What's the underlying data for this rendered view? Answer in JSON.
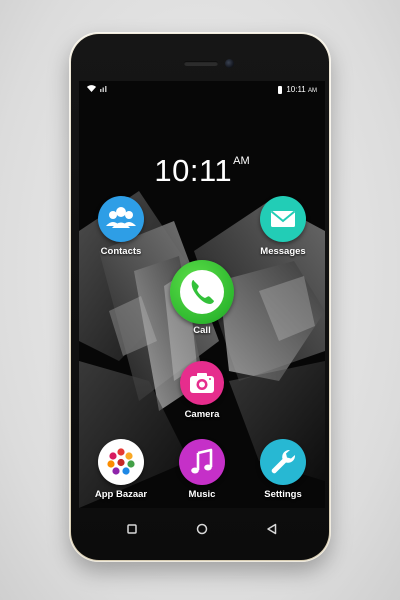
{
  "status_bar": {
    "time": "10:11",
    "ampm": "AM"
  },
  "clock": {
    "time": "10:11",
    "ampm": "AM"
  },
  "apps": {
    "contacts": {
      "label": "Contacts",
      "icon": "contacts-icon",
      "color": "#2e9ee6"
    },
    "messages": {
      "label": "Messages",
      "icon": "envelope-icon",
      "color": "#22cdb6"
    },
    "call": {
      "label": "Call",
      "icon": "phone-icon",
      "color": "#34c83a"
    },
    "camera": {
      "label": "Camera",
      "icon": "camera-icon",
      "color": "#e62d8d"
    },
    "app_bazaar": {
      "label": "App Bazaar",
      "icon": "app-bazaar-icon",
      "color": "#ffffff"
    },
    "music": {
      "label": "Music",
      "icon": "music-note-icon",
      "color": "#c530c8"
    },
    "settings": {
      "label": "Settings",
      "icon": "wrench-icon",
      "color": "#27b8d3"
    }
  },
  "nav": {
    "recents": "recents-square-icon",
    "home": "home-circle-icon",
    "back": "back-triangle-icon"
  }
}
